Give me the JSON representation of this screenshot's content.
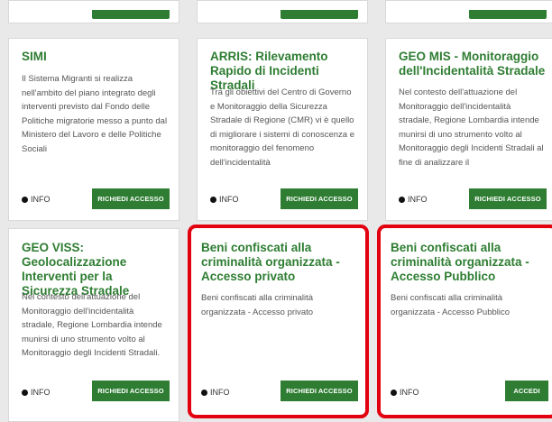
{
  "cards": [
    {
      "title": "SIMI",
      "description": "Il Sistema Migranti si realizza nell'ambito del piano integrato degli interventi previsto dal Fondo delle Politiche migratorie messo a punto dal Ministero del Lavoro e delle Politiche Sociali",
      "info_label": "INFO",
      "button_label": "RICHIEDI ACCESSO"
    },
    {
      "title": "ARRIS: Rilevamento Rapido di Incidenti Stradali",
      "description": "Tra gli obiettivi del Centro di Governo e Monitoraggio della Sicurezza Stradale di Regione (CMR) vi è quello di migliorare i sistemi di conoscenza e monitoraggio del fenomeno dell'incidentalità",
      "info_label": "INFO",
      "button_label": "RICHIEDI ACCESSO"
    },
    {
      "title": "GEO MIS - Monitoraggio dell'Incidentalità Stradale",
      "description": "Nel contesto dell'attuazione del Monitoraggio dell'incidentalità stradale, Regione Lombardia intende munirsi di uno strumento volto al Monitoraggio degli Incidenti Stradali al fine di analizzare il",
      "info_label": "INFO",
      "button_label": "RICHIEDI ACCESSO"
    },
    {
      "title": "GEO VISS: Geolocalizzazione Interventi per la Sicurezza Stradale",
      "description": "Nel contesto dell'attuazione del Monitoraggio dell'incidentalità stradale, Regione Lombardia intende munirsi di uno strumento volto al Monitoraggio degli Incidenti Stradali.",
      "info_label": "INFO",
      "button_label": "RICHIEDI ACCESSO"
    },
    {
      "title": "Beni confiscati alla criminalità organizzata - Accesso privato",
      "description": "Beni confiscati alla criminalità organizzata - Accesso privato",
      "info_label": "INFO",
      "button_label": "RICHIEDI ACCESSO"
    },
    {
      "title": "Beni confiscati alla criminalità organizzata - Accesso Pubblico",
      "description": "Beni confiscati alla criminalità organizzata - Accesso Pubblico",
      "info_label": "INFO",
      "button_label": "ACCEDI"
    }
  ],
  "colors": {
    "primary_green": "#2e7d32",
    "highlight_red": "#e3000f"
  }
}
